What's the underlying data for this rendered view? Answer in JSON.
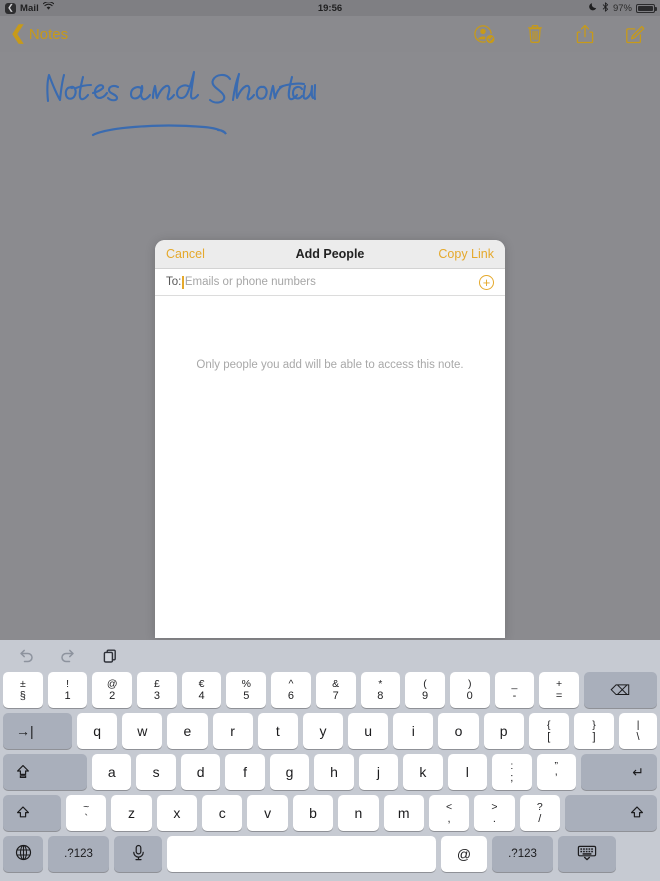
{
  "statusbar": {
    "back_app": "Mail",
    "back_chevron": "❮",
    "wifi_icon": "wifi-icon",
    "time": "19:56",
    "dnd_icon": "moon-icon",
    "bluetooth_icon": "bluetooth-icon",
    "battery_percent": "97%",
    "battery_level": 97
  },
  "navbar": {
    "back_label": "Notes",
    "back_chevron": "❮",
    "actions": [
      {
        "name": "add-collaborator-icon",
        "label": "Add People"
      },
      {
        "name": "trash-icon",
        "label": "Delete"
      },
      {
        "name": "share-icon",
        "label": "Share"
      },
      {
        "name": "compose-icon",
        "label": "Compose"
      }
    ]
  },
  "note": {
    "handwriting_text": "Notes and Shortcuts",
    "ink_color": "#3a6bb0"
  },
  "modal": {
    "cancel_label": "Cancel",
    "title": "Add People",
    "copy_link_label": "Copy Link",
    "to_label": "To:",
    "to_value": "",
    "to_placeholder": "Emails or phone numbers",
    "add_button_glyph": "+",
    "info_text": "Only people you add will be able to access this note.",
    "accent_color": "#e5a92c"
  },
  "keyboard": {
    "toolbar": [
      {
        "name": "undo-icon",
        "label": "Undo",
        "enabled": false
      },
      {
        "name": "redo-icon",
        "label": "Redo",
        "enabled": false
      },
      {
        "name": "paste-icon",
        "label": "Paste",
        "enabled": true
      }
    ],
    "row_numbers": [
      {
        "top": "±",
        "bot": "§"
      },
      {
        "top": "!",
        "bot": "1"
      },
      {
        "top": "@",
        "bot": "2"
      },
      {
        "top": "£",
        "bot": "3"
      },
      {
        "top": "€",
        "bot": "4"
      },
      {
        "top": "%",
        "bot": "5"
      },
      {
        "top": "^",
        "bot": "6"
      },
      {
        "top": "&",
        "bot": "7"
      },
      {
        "top": "*",
        "bot": "8"
      },
      {
        "top": "(",
        "bot": "9"
      },
      {
        "top": ")",
        "bot": "0"
      },
      {
        "top": "_",
        "bot": "-"
      },
      {
        "top": "+",
        "bot": "="
      }
    ],
    "backspace_label": "⌫",
    "tab_label": "→|",
    "row_q": [
      "q",
      "w",
      "e",
      "r",
      "t",
      "y",
      "u",
      "i",
      "o",
      "p"
    ],
    "row_q_extra": [
      {
        "top": "{",
        "bot": "["
      },
      {
        "top": "}",
        "bot": "]"
      },
      {
        "top": "|",
        "bot": "\\"
      }
    ],
    "capslock_label": "⇧",
    "row_a": [
      "a",
      "s",
      "d",
      "f",
      "g",
      "h",
      "j",
      "k",
      "l"
    ],
    "row_a_extra": [
      {
        "top": ":",
        "bot": ";"
      },
      {
        "top": "”",
        "bot": "’"
      }
    ],
    "return_label": "↵",
    "shift_label": "⇧",
    "row_z_pre": [
      {
        "top": "~",
        "bot": "`"
      }
    ],
    "row_z": [
      "z",
      "x",
      "c",
      "v",
      "b",
      "n",
      "m"
    ],
    "row_z_extra": [
      {
        "top": "<",
        "bot": ","
      },
      {
        "top": ">",
        "bot": "."
      },
      {
        "top": "?",
        "bot": "/"
      }
    ],
    "globe_label": "globe-icon",
    "numbers_label": ".?123",
    "mic_label": "mic-icon",
    "space_label": "",
    "at_label": "@",
    "numbers_label_right": ".?123",
    "hide_keyboard_label": "hide-keyboard-icon"
  }
}
